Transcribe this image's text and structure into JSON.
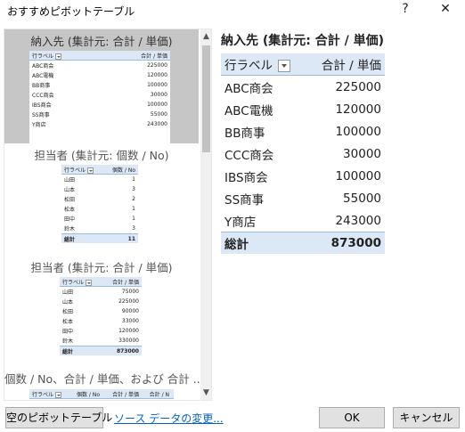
{
  "window": {
    "title": "おすすめピボットテーブル",
    "help_glyph": "?",
    "close_glyph": "✕"
  },
  "recommendations": [
    {
      "title": "納入先 (集計元: 合計 / 単価)",
      "selected": true,
      "mini_table": {
        "col1": "行ラベル",
        "col2": "合計 / 単価",
        "rows": [
          [
            "ABC商会",
            "225000"
          ],
          [
            "ABC電機",
            "120000"
          ],
          [
            "BB商事",
            "100000"
          ],
          [
            "CCC商会",
            "30000"
          ],
          [
            "IBS商会",
            "100000"
          ],
          [
            "SS商事",
            "55000"
          ],
          [
            "Y商店",
            "243000"
          ]
        ]
      }
    },
    {
      "title": "担当者 (集計元: 個数 / No)",
      "selected": false,
      "mini_table": {
        "col1": "行ラベル",
        "col2": "個数 / No",
        "rows": [
          [
            "山田",
            "1"
          ],
          [
            "山本",
            "3"
          ],
          [
            "松田",
            "2"
          ],
          [
            "松本",
            "1"
          ],
          [
            "田中",
            "1"
          ],
          [
            "鈴木",
            "3"
          ]
        ],
        "total": [
          "総計",
          "11"
        ]
      }
    },
    {
      "title": "担当者 (集計元: 合計 / 単価)",
      "selected": false,
      "mini_table": {
        "col1": "行ラベル",
        "col2": "合計 / 単価",
        "rows": [
          [
            "山田",
            "75000"
          ],
          [
            "山本",
            "225000"
          ],
          [
            "松田",
            "90000"
          ],
          [
            "松本",
            "33000"
          ],
          [
            "田中",
            "120000"
          ],
          [
            "鈴木",
            "330000"
          ]
        ],
        "total": [
          "総計",
          "873000"
        ]
      }
    },
    {
      "title": "個数 / No、合計 / 単価、および 合計 ...",
      "selected": false,
      "mini_header": [
        "行ラベル",
        "個数 / No",
        "合計 / 単価",
        "合計 / N"
      ]
    }
  ],
  "preview": {
    "title": "納入先 (集計元: 合計 / 単価)",
    "col1": "行ラベル",
    "col2": "合計 / 単価",
    "rows": [
      [
        "ABC商会",
        "225000"
      ],
      [
        "ABC電機",
        "120000"
      ],
      [
        "BB商事",
        "100000"
      ],
      [
        "CCC商会",
        "30000"
      ],
      [
        "IBS商会",
        "100000"
      ],
      [
        "SS商事",
        "55000"
      ],
      [
        "Y商店",
        "243000"
      ]
    ],
    "total": [
      "総計",
      "873000"
    ]
  },
  "footer": {
    "blank_pivot_label": "空のピボットテーブル",
    "change_source_label": "ソース データの変更...",
    "ok_label": "OK",
    "cancel_label": "キャンセル"
  },
  "colors": {
    "header_fill": "#dce8f5",
    "selected_fill": "#c6c6c6",
    "link": "#0563c1"
  }
}
